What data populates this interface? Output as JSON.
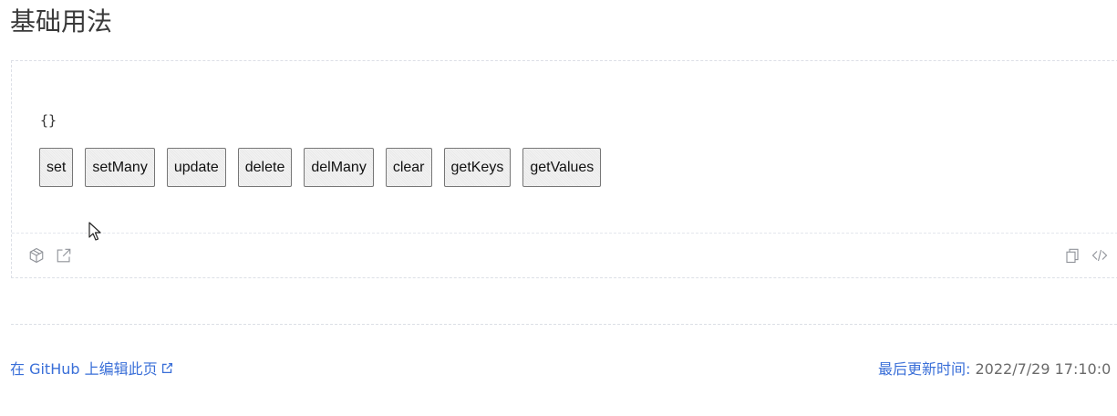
{
  "page": {
    "title": "基础用法"
  },
  "demo": {
    "output": "{}",
    "buttons": [
      "set",
      "setMany",
      "update",
      "delete",
      "delMany",
      "clear",
      "getKeys",
      "getValues"
    ],
    "toolbar": {
      "left_icons": [
        "codesandbox-icon",
        "external-link-icon"
      ],
      "right_icons": [
        "copy-icon",
        "code-icon"
      ]
    }
  },
  "footer": {
    "edit_link": "在 GitHub 上编辑此页",
    "last_updated_label": "最后更新时间:",
    "last_updated_value": "2022/7/29 17:10:0"
  }
}
